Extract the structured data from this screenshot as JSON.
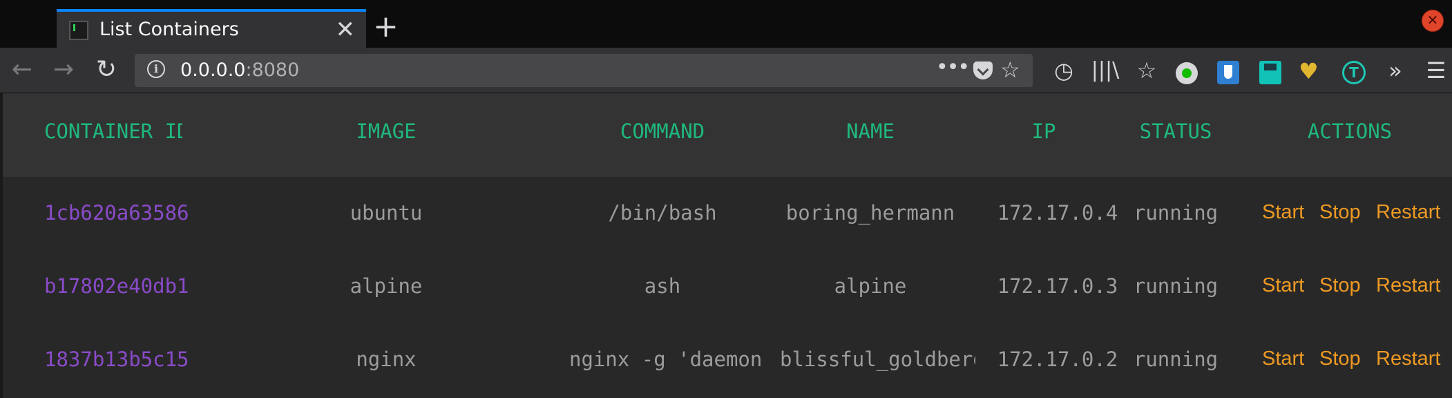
{
  "browser": {
    "tab_title": "List Containers",
    "tab_close": "✕",
    "new_tab": "+",
    "window_close": "✕",
    "url_host": "0.0.0.0",
    "url_port": ":8080",
    "page_actions": "•••",
    "icons": [
      "back-icon",
      "forward-icon",
      "reload-icon",
      "site-info-icon",
      "page-actions-icon",
      "pocket-icon",
      "bookmark-star-icon",
      "history-icon",
      "library-icon",
      "bookmarks-menu-icon",
      "extension-green-dot-icon",
      "bitwarden-icon",
      "save-icon",
      "colorful-heart-icon",
      "t-extension-icon",
      "overflow-icon",
      "hamburger-menu-icon"
    ]
  },
  "table": {
    "headers": [
      "CONTAINER ID",
      "IMAGE",
      "COMMAND",
      "NAME",
      "IP",
      "STATUS",
      "ACTIONS"
    ],
    "rows": [
      {
        "id": "1cb620a63586",
        "image": "ubuntu",
        "command": "/bin/bash",
        "name": "boring_hermann",
        "ip": "172.17.0.4",
        "status": "running"
      },
      {
        "id": "b17802e40db1",
        "image": "alpine",
        "command": "ash",
        "name": "alpine",
        "ip": "172.17.0.3",
        "status": "running"
      },
      {
        "id": "1837b13b5c15",
        "image": "nginx",
        "command": "nginx -g 'daemon off;'",
        "name": "blissful_goldberg",
        "ip": "172.17.0.2",
        "status": "running"
      }
    ],
    "actions": [
      "Start",
      "Stop",
      "Restart"
    ]
  },
  "colors": {
    "header_text": "#1fb87d",
    "container_id": "#8a4bc9",
    "action_link": "#ee9a24",
    "cell_text": "#9c9c9c",
    "tab_accent": "#0a84ff"
  }
}
